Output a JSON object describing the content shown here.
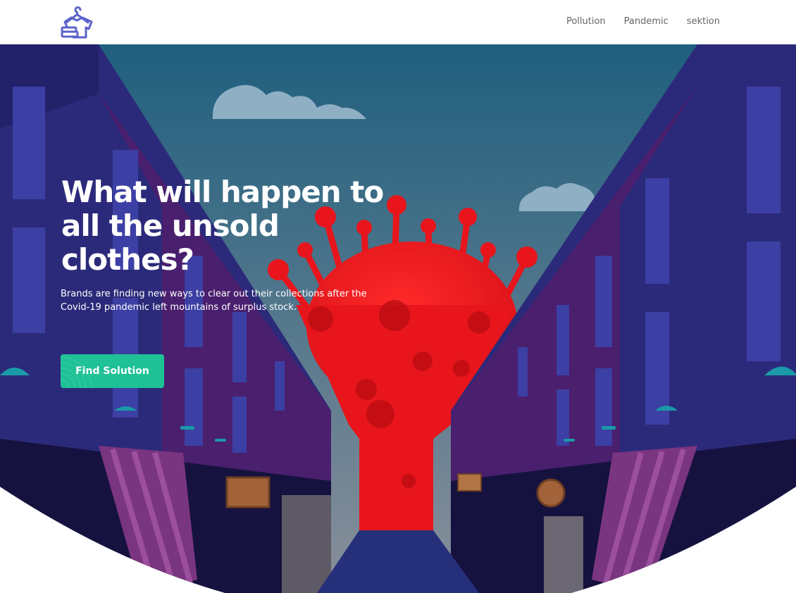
{
  "header": {
    "logo_icon": "clothes-hanger-shirt-icon",
    "nav": [
      {
        "label": "Pollution"
      },
      {
        "label": "Pandemic"
      },
      {
        "label": "sektion"
      }
    ]
  },
  "hero": {
    "headline": "What will happen to all the unsold clothes?",
    "subtext": "Brands are finding new ways to clear out their collections after the Covid-19 pandemic left mountains of surplus stock.",
    "cta_label": "Find Solution",
    "illustration": "virus-over-city-street-illustration"
  },
  "colors": {
    "accent": "#1fc196",
    "logo": "#5b63c9",
    "virus": "#e8151c",
    "sky_top": "#1f5f7e",
    "sky_bottom": "#7b8897",
    "building_dark": "#2b2a7a",
    "building_purple": "#4a1f6e"
  }
}
